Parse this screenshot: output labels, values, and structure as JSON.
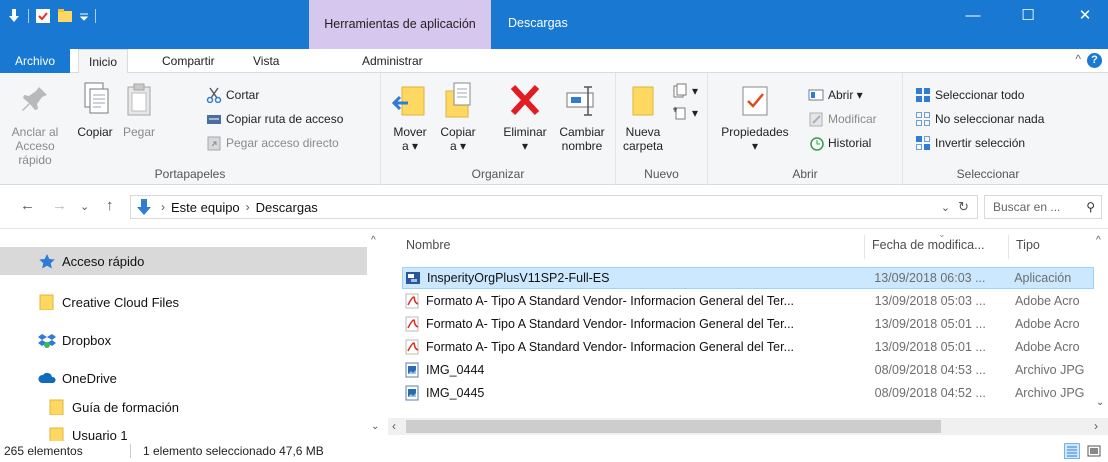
{
  "window": {
    "context_tab_group": "Herramientas de aplicación",
    "title": "Descargas",
    "controls": {
      "minimize": "—",
      "maximize": "☐",
      "close": "✕"
    }
  },
  "tabs": {
    "file": "Archivo",
    "home": "Inicio",
    "share": "Compartir",
    "view": "Vista",
    "manage": "Administrar"
  },
  "ribbon": {
    "clipboard": {
      "label": "Portapapeles",
      "pin_line1": "Anclar al",
      "pin_line2": "Acceso rápido",
      "copy": "Copiar",
      "paste": "Pegar",
      "cut": "Cortar",
      "copy_path": "Copiar ruta de acceso",
      "paste_shortcut": "Pegar acceso directo"
    },
    "organize": {
      "label": "Organizar",
      "move_line1": "Mover",
      "move_line2": "a ▾",
      "copy_line1": "Copiar",
      "copy_line2": "a ▾",
      "delete_line1": "Eliminar",
      "delete_line2": "▾",
      "rename_line1": "Cambiar",
      "rename_line2": "nombre"
    },
    "new": {
      "label": "Nuevo",
      "folder_line1": "Nueva",
      "folder_line2": "carpeta"
    },
    "open": {
      "label": "Abrir",
      "properties": "Propiedades",
      "properties_arrow": "▾",
      "open": "Abrir ▾",
      "modify": "Modificar",
      "history": "Historial"
    },
    "select": {
      "label": "Seleccionar",
      "select_all": "Seleccionar todo",
      "select_none": "No seleccionar nada",
      "invert": "Invertir selección"
    }
  },
  "address": {
    "path": [
      "Este equipo",
      "Descargas"
    ],
    "search_placeholder": "Buscar en ..."
  },
  "nav": {
    "items": [
      {
        "label": "Acceso rápido"
      },
      {
        "label": "Creative Cloud Files"
      },
      {
        "label": "Dropbox"
      },
      {
        "label": "OneDrive"
      },
      {
        "label": "Guía de formación"
      },
      {
        "label": "Usuario 1"
      }
    ]
  },
  "files": {
    "columns": {
      "name": "Nombre",
      "date": "Fecha de modifica...",
      "type": "Tipo"
    },
    "rows": [
      {
        "name": "InsperityOrgPlusV11SP2-Full-ES",
        "date": "13/09/2018 06:03 ...",
        "type": "Aplicación",
        "icon": "app-icon"
      },
      {
        "name": "Formato A- Tipo A Standard Vendor- Informacion General del Ter...",
        "date": "13/09/2018 05:03 ...",
        "type": "Adobe Acro",
        "icon": "pdf-icon"
      },
      {
        "name": "Formato A- Tipo A Standard Vendor- Informacion General del Ter...",
        "date": "13/09/2018 05:01 ...",
        "type": "Adobe Acro",
        "icon": "pdf-icon"
      },
      {
        "name": "Formato A- Tipo A Standard Vendor- Informacion General del Ter...",
        "date": "13/09/2018 05:01 ...",
        "type": "Adobe Acro",
        "icon": "pdf-icon"
      },
      {
        "name": "IMG_0444",
        "date": "08/09/2018 04:53 ...",
        "type": "Archivo JPG",
        "icon": "image-icon"
      },
      {
        "name": "IMG_0445",
        "date": "08/09/2018 04:52 ...",
        "type": "Archivo JPG",
        "icon": "image-icon"
      }
    ]
  },
  "status": {
    "count": "265 elementos",
    "selection": "1 elemento seleccionado  47,6 MB"
  },
  "colors": {
    "accent": "#1979d2",
    "context": "#d6c7ee",
    "selection": "#cce8ff"
  }
}
